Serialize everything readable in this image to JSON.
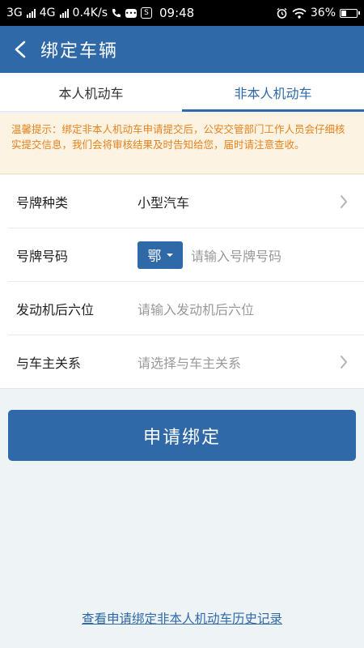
{
  "status_bar": {
    "network1": "3G",
    "network2": "4G",
    "speed": "0.4K/s",
    "time": "09:48",
    "battery": "36%",
    "battery_level": 0.36
  },
  "header": {
    "title": "绑定车辆"
  },
  "tabs": [
    {
      "label": "本人机动车",
      "active": false
    },
    {
      "label": "非本人机动车",
      "active": true
    }
  ],
  "notice": {
    "text": "温馨提示：绑定非本人机动车申请提交后，公安交管部门工作人员会仔细核实提交信息，我们会将审核结果及时告知给您，届时请注意查收。"
  },
  "form": {
    "plate_type": {
      "label": "号牌种类",
      "value": "小型汽车"
    },
    "plate_number": {
      "label": "号牌号码",
      "province": "鄂",
      "placeholder": "请输入号牌号码"
    },
    "engine": {
      "label": "发动机后六位",
      "placeholder": "请输入发动机后六位"
    },
    "relation": {
      "label": "与车主关系",
      "placeholder": "请选择与车主关系"
    }
  },
  "submit_label": "申请绑定",
  "history_link": "查看申请绑定非本人机动车历史记录",
  "colors": {
    "primary": "#2f69a8",
    "notice_text": "#e5821e",
    "notice_bg": "#fdf3e2"
  }
}
